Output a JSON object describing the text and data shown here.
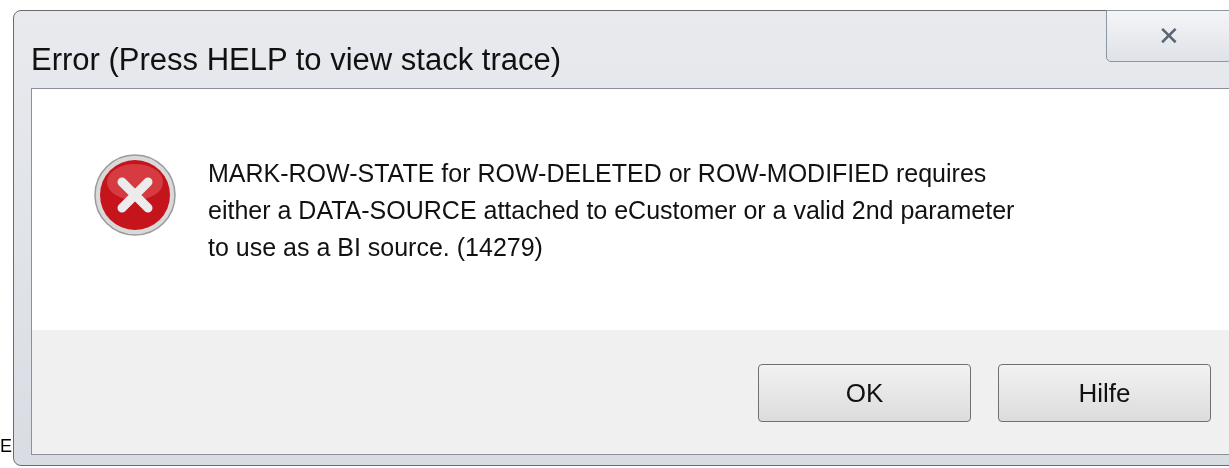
{
  "window": {
    "title": "Error (Press HELP to view stack trace)",
    "close": "✕"
  },
  "message": {
    "kind": "error",
    "lines": [
      "MARK-ROW-STATE for ROW-DELETED or ROW-MODIFIED requires",
      "either a DATA-SOURCE attached to eCustomer or a valid 2nd parameter",
      "to use as a BI source. (14279)"
    ]
  },
  "buttons": [
    {
      "label": "OK"
    },
    {
      "label": "Hilfe"
    }
  ],
  "background_fragment": "E"
}
